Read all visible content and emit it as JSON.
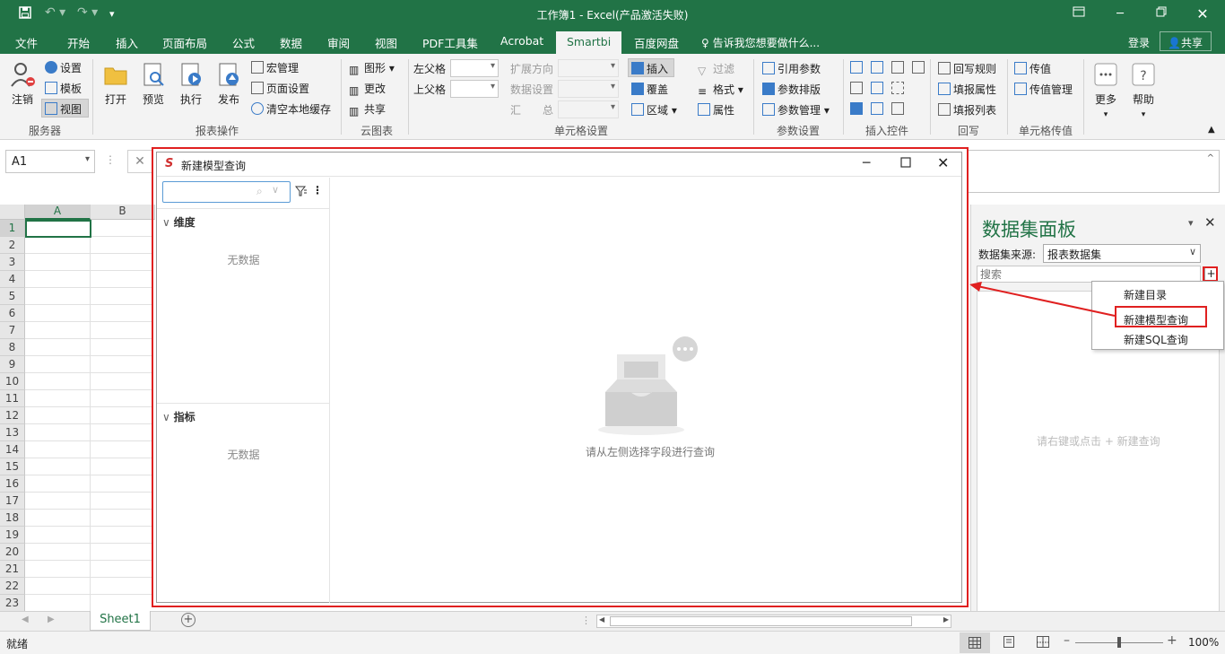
{
  "app": {
    "title": "工作簿1 - Excel(产品激活失败)",
    "tabs": [
      "文件",
      "开始",
      "插入",
      "页面布局",
      "公式",
      "数据",
      "审阅",
      "视图",
      "PDF工具集",
      "Acrobat",
      "Smartbi",
      "百度网盘"
    ],
    "active_tab": "Smartbi",
    "tell_me": "告诉我您想要做什么...",
    "login": "登录",
    "share": "共享",
    "accent_color": "#217346"
  },
  "ribbon": {
    "server": {
      "logout": "注销",
      "settings": "设置",
      "template": "模板",
      "view": "视图",
      "group": "服务器"
    },
    "report_ops": {
      "open": "打开",
      "preview": "预览",
      "execute": "执行",
      "publish": "发布",
      "macro": "宏管理",
      "page_setup": "页面设置",
      "clear_cache": "清空本地缓存",
      "group": "报表操作"
    },
    "cloud_chart": {
      "chart": "图形",
      "change": "更改",
      "share": "共享",
      "group": "云图表"
    },
    "cell_settings": {
      "left_parent": "左父格",
      "top_parent": "上父格",
      "expand_dir": "扩展方向",
      "data_setting": "数据设置",
      "summary": "汇　　总",
      "insert": "插入",
      "overwrite": "覆盖",
      "region": "区域",
      "filter": "过滤",
      "format": "格式",
      "attribute": "属性",
      "group": "单元格设置"
    },
    "param_settings": {
      "ref_param": "引用参数",
      "param_layout": "参数排版",
      "param_mgmt": "参数管理",
      "group": "参数设置"
    },
    "insert_controls": {
      "group": "插入控件"
    },
    "writeback": {
      "rule": "回写规则",
      "fill_attr": "填报属性",
      "fill_list": "填报列表",
      "group": "回写"
    },
    "cell_pass": {
      "pass_value": "传值",
      "pass_mgmt": "传值管理",
      "group": "单元格传值"
    },
    "more": "更多",
    "help": "帮助"
  },
  "formula_bar": {
    "name_box": "A1"
  },
  "sheet": {
    "columns": [
      "A",
      "B"
    ],
    "rows": [
      "1",
      "2",
      "3",
      "4",
      "5",
      "6",
      "7",
      "8",
      "9",
      "10",
      "11",
      "12",
      "13",
      "14",
      "15",
      "16",
      "17",
      "18",
      "19",
      "20",
      "21",
      "22",
      "23"
    ],
    "tab": "Sheet1"
  },
  "status": {
    "ready": "就绪",
    "zoom": "100%"
  },
  "dialog": {
    "title": "新建模型查询",
    "dimension": "维度",
    "measure": "指标",
    "no_data": "无数据",
    "hint": "请从左侧选择字段进行查询"
  },
  "panel": {
    "title": "数据集面板",
    "source_label": "数据集来源:",
    "source_value": "报表数据集",
    "search_placeholder": "搜索",
    "empty_hint": "请右键或点击 + 新建查询",
    "plus": "+"
  },
  "context_menu": {
    "items": [
      "新建目录",
      "新建模型查询",
      "新建SQL查询"
    ]
  }
}
